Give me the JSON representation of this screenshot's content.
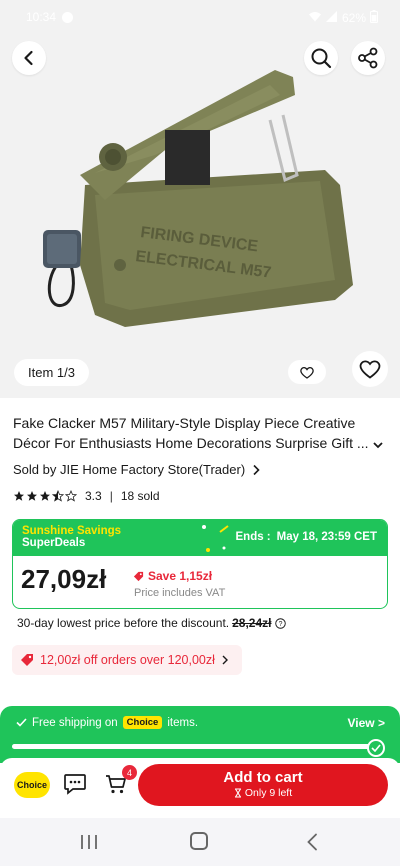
{
  "status_bar": {
    "time": "10:34",
    "battery": "62%"
  },
  "gallery": {
    "counter": "Item 1/3"
  },
  "product": {
    "title": "Fake Clacker M57 Military-Style Display Piece Creative Décor For Enthusiasts Home Decorations Surprise Gift ...",
    "seller": "Sold by JIE Home Factory Store(Trader)",
    "rating": 3.3,
    "rating_label": "3.3",
    "sold": "18 sold",
    "engraving_line1": "FIRING DEVICE",
    "engraving_line2": "ELECTRICAL M57"
  },
  "deal": {
    "brand_line1": "Sunshine Savings",
    "brand_line2": "SuperDeals",
    "ends_label": "Ends :",
    "ends_value": "May 18, 23:59 CET",
    "price": "27,09zł",
    "save": "Save 1,15zł",
    "vat": "Price includes VAT"
  },
  "lowest_price": {
    "text": "30-day lowest price before the discount.",
    "old_price": "28,24zł"
  },
  "coupon": {
    "text": "12,00zł off orders over 120,00zł"
  },
  "shipping": {
    "prefix": "Free shipping on",
    "tag": "Choice",
    "suffix": "items.",
    "view": "View >",
    "progress": 1.0
  },
  "actions": {
    "choice_badge": "Choice",
    "cart_count": "4",
    "add_to_cart": "Add to cart",
    "stock": "Only 9 left"
  },
  "colors": {
    "green": "#1fc45a",
    "red": "#e0161f",
    "yellow": "#ffe400"
  }
}
